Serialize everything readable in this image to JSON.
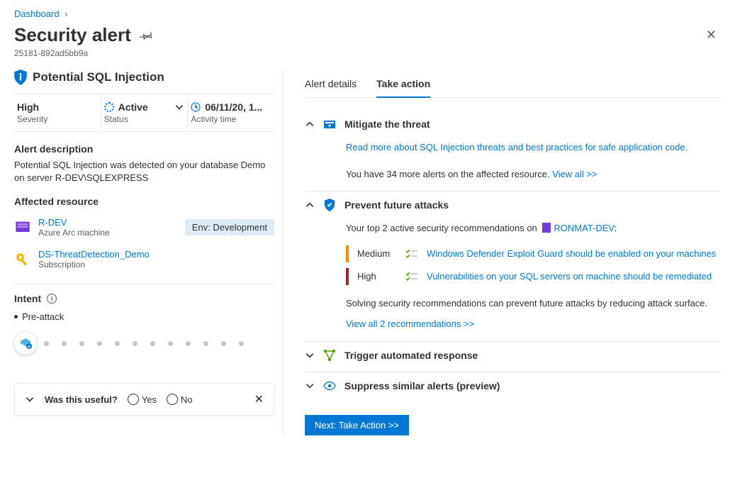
{
  "breadcrumb": {
    "root": "Dashboard"
  },
  "page_title": "Security alert",
  "page_subtitle": "25181-892ad5bb9a",
  "alert": {
    "title": "Potential SQL Injection",
    "severity": {
      "value": "High",
      "label": "Severity"
    },
    "status": {
      "value": "Active",
      "label": "Status"
    },
    "time": {
      "value": "06/11/20, 1...",
      "label": "Activity time"
    },
    "description_title": "Alert description",
    "description": "Potential SQL Injection was detected on your database Demo on server R-DEV\\SQLEXPRESS"
  },
  "affected": {
    "title": "Affected resource",
    "items": [
      {
        "name": "R-DEV",
        "type": "Azure Arc machine",
        "badge": "Env: Development"
      },
      {
        "name": "DS-ThreatDetection_Demo",
        "type": "Subscription"
      }
    ]
  },
  "intent": {
    "title": "Intent",
    "stage": "Pre-attack"
  },
  "useful": {
    "question": "Was this useful?",
    "yes": "Yes",
    "no": "No"
  },
  "tabs": {
    "details": "Alert details",
    "action": "Take action"
  },
  "mitigate": {
    "title": "Mitigate the threat",
    "link": "Read more about SQL Injection threats and best practices for safe application code.",
    "more_prefix": "You have 34 more alerts on the affected resource. ",
    "view_all": "View all >>"
  },
  "prevent": {
    "title": "Prevent future attacks",
    "intro_prefix": "Your top 2 active security recommendations on ",
    "resource": "RONMAT-DEV",
    "recs": [
      {
        "sev": "Medium",
        "text": "Windows Defender Exploit Guard should be enabled on your machines"
      },
      {
        "sev": "High",
        "text": "Vulnerabilities on your SQL servers on machine should be remediated"
      }
    ],
    "footer": "Solving security recommendations can prevent future attacks by reducing attack surface.",
    "view_all": "View all 2 recommendations >>"
  },
  "trigger": {
    "title": "Trigger automated response"
  },
  "suppress": {
    "title": "Suppress similar alerts (preview)"
  },
  "next_button": "Next: Take Action >>"
}
